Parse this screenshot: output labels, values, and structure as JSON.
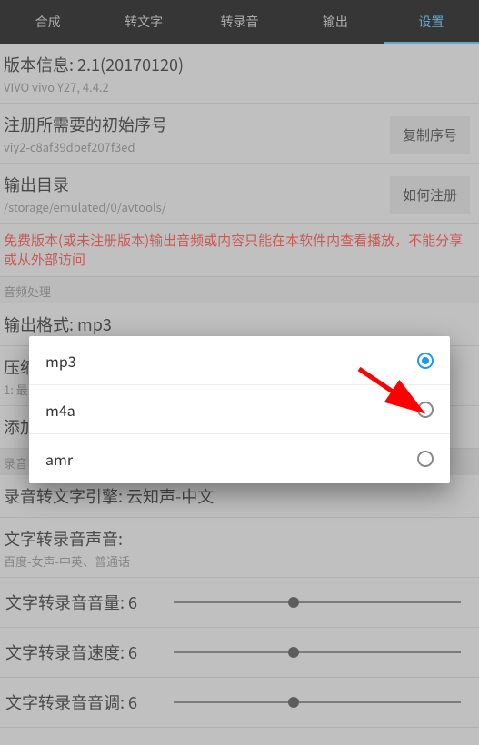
{
  "tabs": [
    {
      "label": "合成"
    },
    {
      "label": "转文字"
    },
    {
      "label": "转录音"
    },
    {
      "label": "输出"
    },
    {
      "label": "设置"
    }
  ],
  "version": {
    "title": "版本信息: 2.1(20170120)",
    "sub": "VIVO vivo Y27, 4.4.2"
  },
  "serial": {
    "title": "注册所需要的初始序号",
    "sub": "viy2-c8af39dbef207f3ed",
    "btn": "复制序号"
  },
  "outdir": {
    "title": "输出目录",
    "sub": "/storage/emulated/0/avtools/",
    "btn": "如何注册"
  },
  "redNotice": "免费版本(或未注册版本)输出音频或内容只能在本软件内查看播放，不能分享或从外部访问",
  "audioProcLabel": "音频处理",
  "format": {
    "title": "输出格式: mp3"
  },
  "compress": {
    "title": "压缩",
    "sub": "1: 最"
  },
  "addTitle": "添加",
  "recLabel": "录音",
  "engine": "录音转文字引擎: 云知声-中文",
  "ttsVoice": {
    "title": "文字转录音声音:",
    "sub": "百度-女声-中英、普通话"
  },
  "sliders": [
    {
      "label": "文字转录音音量: 6"
    },
    {
      "label": "文字转录音速度: 6"
    },
    {
      "label": "文字转录音音调: 6"
    }
  ],
  "dialog": {
    "options": [
      {
        "label": "mp3",
        "checked": true
      },
      {
        "label": "m4a",
        "checked": false
      },
      {
        "label": "amr",
        "checked": false
      }
    ]
  }
}
